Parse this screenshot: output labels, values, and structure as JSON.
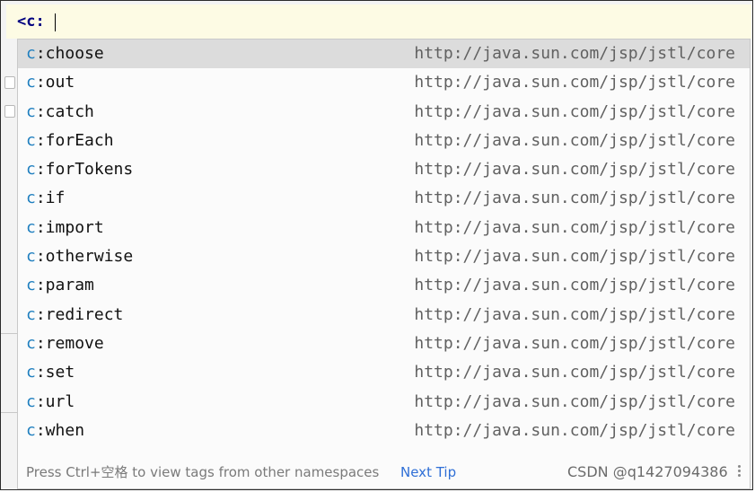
{
  "editor": {
    "typed_text": "<c:"
  },
  "completion": {
    "namespace_prefix": "c",
    "uri": "http://java.sun.com/jsp/jstl/core",
    "selected_index": 0,
    "items": [
      {
        "ns": "c",
        "name": ":choose",
        "uri": "http://java.sun.com/jsp/jstl/core"
      },
      {
        "ns": "c",
        "name": ":out",
        "uri": "http://java.sun.com/jsp/jstl/core"
      },
      {
        "ns": "c",
        "name": ":catch",
        "uri": "http://java.sun.com/jsp/jstl/core"
      },
      {
        "ns": "c",
        "name": ":forEach",
        "uri": "http://java.sun.com/jsp/jstl/core"
      },
      {
        "ns": "c",
        "name": ":forTokens",
        "uri": "http://java.sun.com/jsp/jstl/core"
      },
      {
        "ns": "c",
        "name": ":if",
        "uri": "http://java.sun.com/jsp/jstl/core"
      },
      {
        "ns": "c",
        "name": ":import",
        "uri": "http://java.sun.com/jsp/jstl/core"
      },
      {
        "ns": "c",
        "name": ":otherwise",
        "uri": "http://java.sun.com/jsp/jstl/core"
      },
      {
        "ns": "c",
        "name": ":param",
        "uri": "http://java.sun.com/jsp/jstl/core"
      },
      {
        "ns": "c",
        "name": ":redirect",
        "uri": "http://java.sun.com/jsp/jstl/core"
      },
      {
        "ns": "c",
        "name": ":remove",
        "uri": "http://java.sun.com/jsp/jstl/core"
      },
      {
        "ns": "c",
        "name": ":set",
        "uri": "http://java.sun.com/jsp/jstl/core"
      },
      {
        "ns": "c",
        "name": ":url",
        "uri": "http://java.sun.com/jsp/jstl/core"
      },
      {
        "ns": "c",
        "name": ":when",
        "uri": "http://java.sun.com/jsp/jstl/core"
      }
    ],
    "footer": {
      "hint": "Press Ctrl+空格 to view tags from other namespaces",
      "next_tip": "Next Tip",
      "more_icon": "vertical-ellipsis-icon"
    }
  },
  "watermark": "CSDN @q1427094386",
  "colors": {
    "namespace": "#1f7fbf",
    "link": "#2f6fd6",
    "selected_row": "#dcdcdc",
    "editor_line": "#fdfbe4"
  }
}
